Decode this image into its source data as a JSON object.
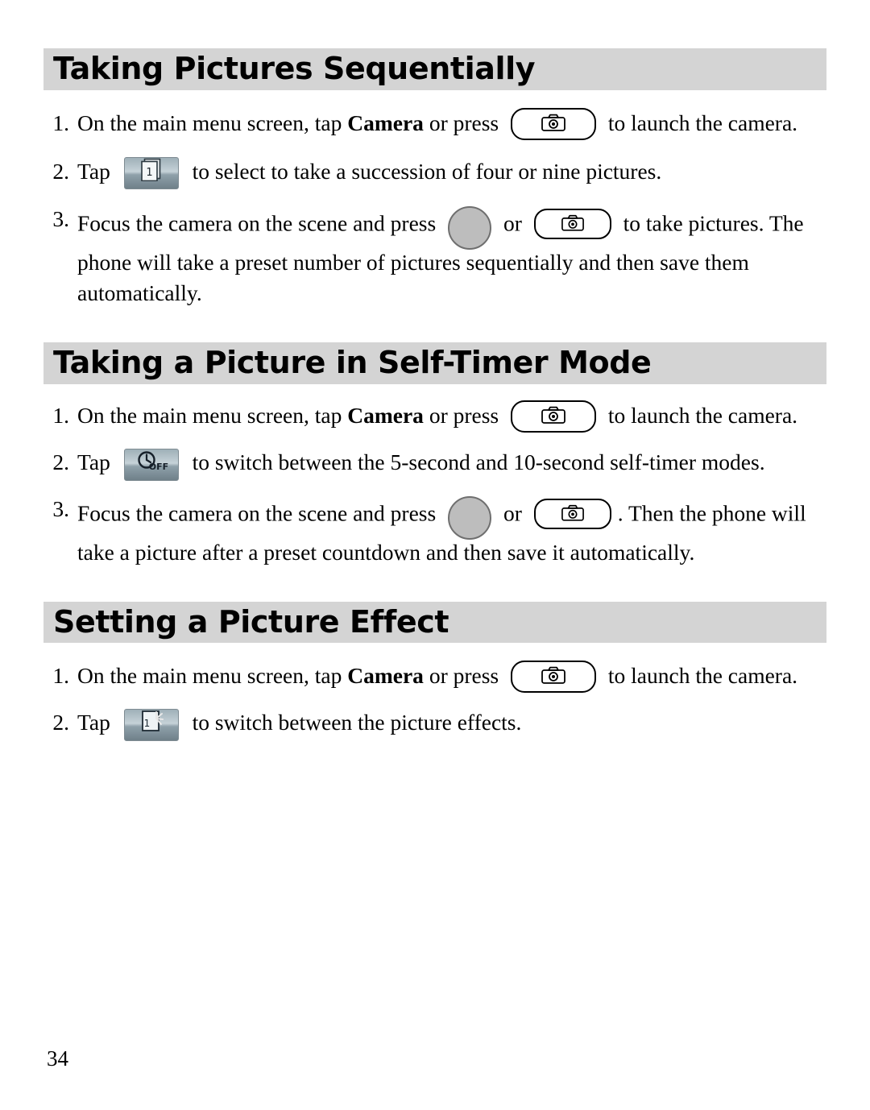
{
  "document": {
    "page_number": "34",
    "sections": [
      {
        "id": "sequential",
        "title": "Taking Pictures Sequentially",
        "steps": [
          {
            "number": "1.",
            "parts": [
              {
                "type": "text",
                "text": "On the main menu screen, tap "
              },
              {
                "type": "bold",
                "text": "Camera"
              },
              {
                "type": "text",
                "text": " or press "
              },
              {
                "type": "icon",
                "icon": "camera-key-button"
              },
              {
                "type": "text",
                "text": " to launch the camera."
              }
            ]
          },
          {
            "number": "2.",
            "parts": [
              {
                "type": "text",
                "text": "Tap "
              },
              {
                "type": "icon",
                "icon": "burst-mode-softkey"
              },
              {
                "type": "text",
                "text": " to select to take a succession of four or nine pictures."
              }
            ]
          },
          {
            "number": "3.",
            "parts": [
              {
                "type": "text",
                "text": "Focus the camera on the scene and press "
              },
              {
                "type": "icon",
                "icon": "shutter-circle-key"
              },
              {
                "type": "text",
                "text": " or "
              },
              {
                "type": "icon",
                "icon": "camera-key-button"
              },
              {
                "type": "text",
                "text": " to take pictures. The phone will take a preset number of pictures sequentially and then save them automatically."
              }
            ]
          }
        ]
      },
      {
        "id": "self-timer",
        "title": "Taking a Picture in Self-Timer Mode",
        "steps": [
          {
            "number": "1.",
            "parts": [
              {
                "type": "text",
                "text": "On the main menu screen, tap "
              },
              {
                "type": "bold",
                "text": "Camera"
              },
              {
                "type": "text",
                "text": " or press "
              },
              {
                "type": "icon",
                "icon": "camera-key-button"
              },
              {
                "type": "text",
                "text": " to launch the camera."
              }
            ]
          },
          {
            "number": "2.",
            "parts": [
              {
                "type": "text",
                "text": "Tap "
              },
              {
                "type": "icon",
                "icon": "self-timer-off-softkey"
              },
              {
                "type": "text",
                "text": " to switch between the 5-second and 10-second self-timer modes."
              }
            ]
          },
          {
            "number": "3.",
            "parts": [
              {
                "type": "text",
                "text": "Focus the camera on the scene and press "
              },
              {
                "type": "icon",
                "icon": "shutter-circle-key"
              },
              {
                "type": "text",
                "text": " or "
              },
              {
                "type": "icon",
                "icon": "camera-key-button"
              },
              {
                "type": "text",
                "text": ". Then the phone will take a picture after a preset countdown and then save it automatically."
              }
            ]
          }
        ]
      },
      {
        "id": "picture-effect",
        "title": "Setting a Picture Effect",
        "steps": [
          {
            "number": "1.",
            "parts": [
              {
                "type": "text",
                "text": "On the main menu screen, tap "
              },
              {
                "type": "bold",
                "text": "Camera"
              },
              {
                "type": "text",
                "text": " or press "
              },
              {
                "type": "icon",
                "icon": "camera-key-button"
              },
              {
                "type": "text",
                "text": " to launch the camera."
              }
            ]
          },
          {
            "number": "2.",
            "parts": [
              {
                "type": "text",
                "text": "Tap "
              },
              {
                "type": "icon",
                "icon": "picture-effect-softkey"
              },
              {
                "type": "text",
                "text": " to switch between the picture effects."
              }
            ]
          }
        ]
      }
    ],
    "icon_labels": {
      "self_timer_off_text": "OFF",
      "burst_frame_digit": "1",
      "effect_frame_digit": "1"
    },
    "colors": {
      "heading_bar": "#d4d4d4",
      "softkey_edge": "#7e8b92",
      "shutter_fill": "#bdbdbd"
    }
  }
}
